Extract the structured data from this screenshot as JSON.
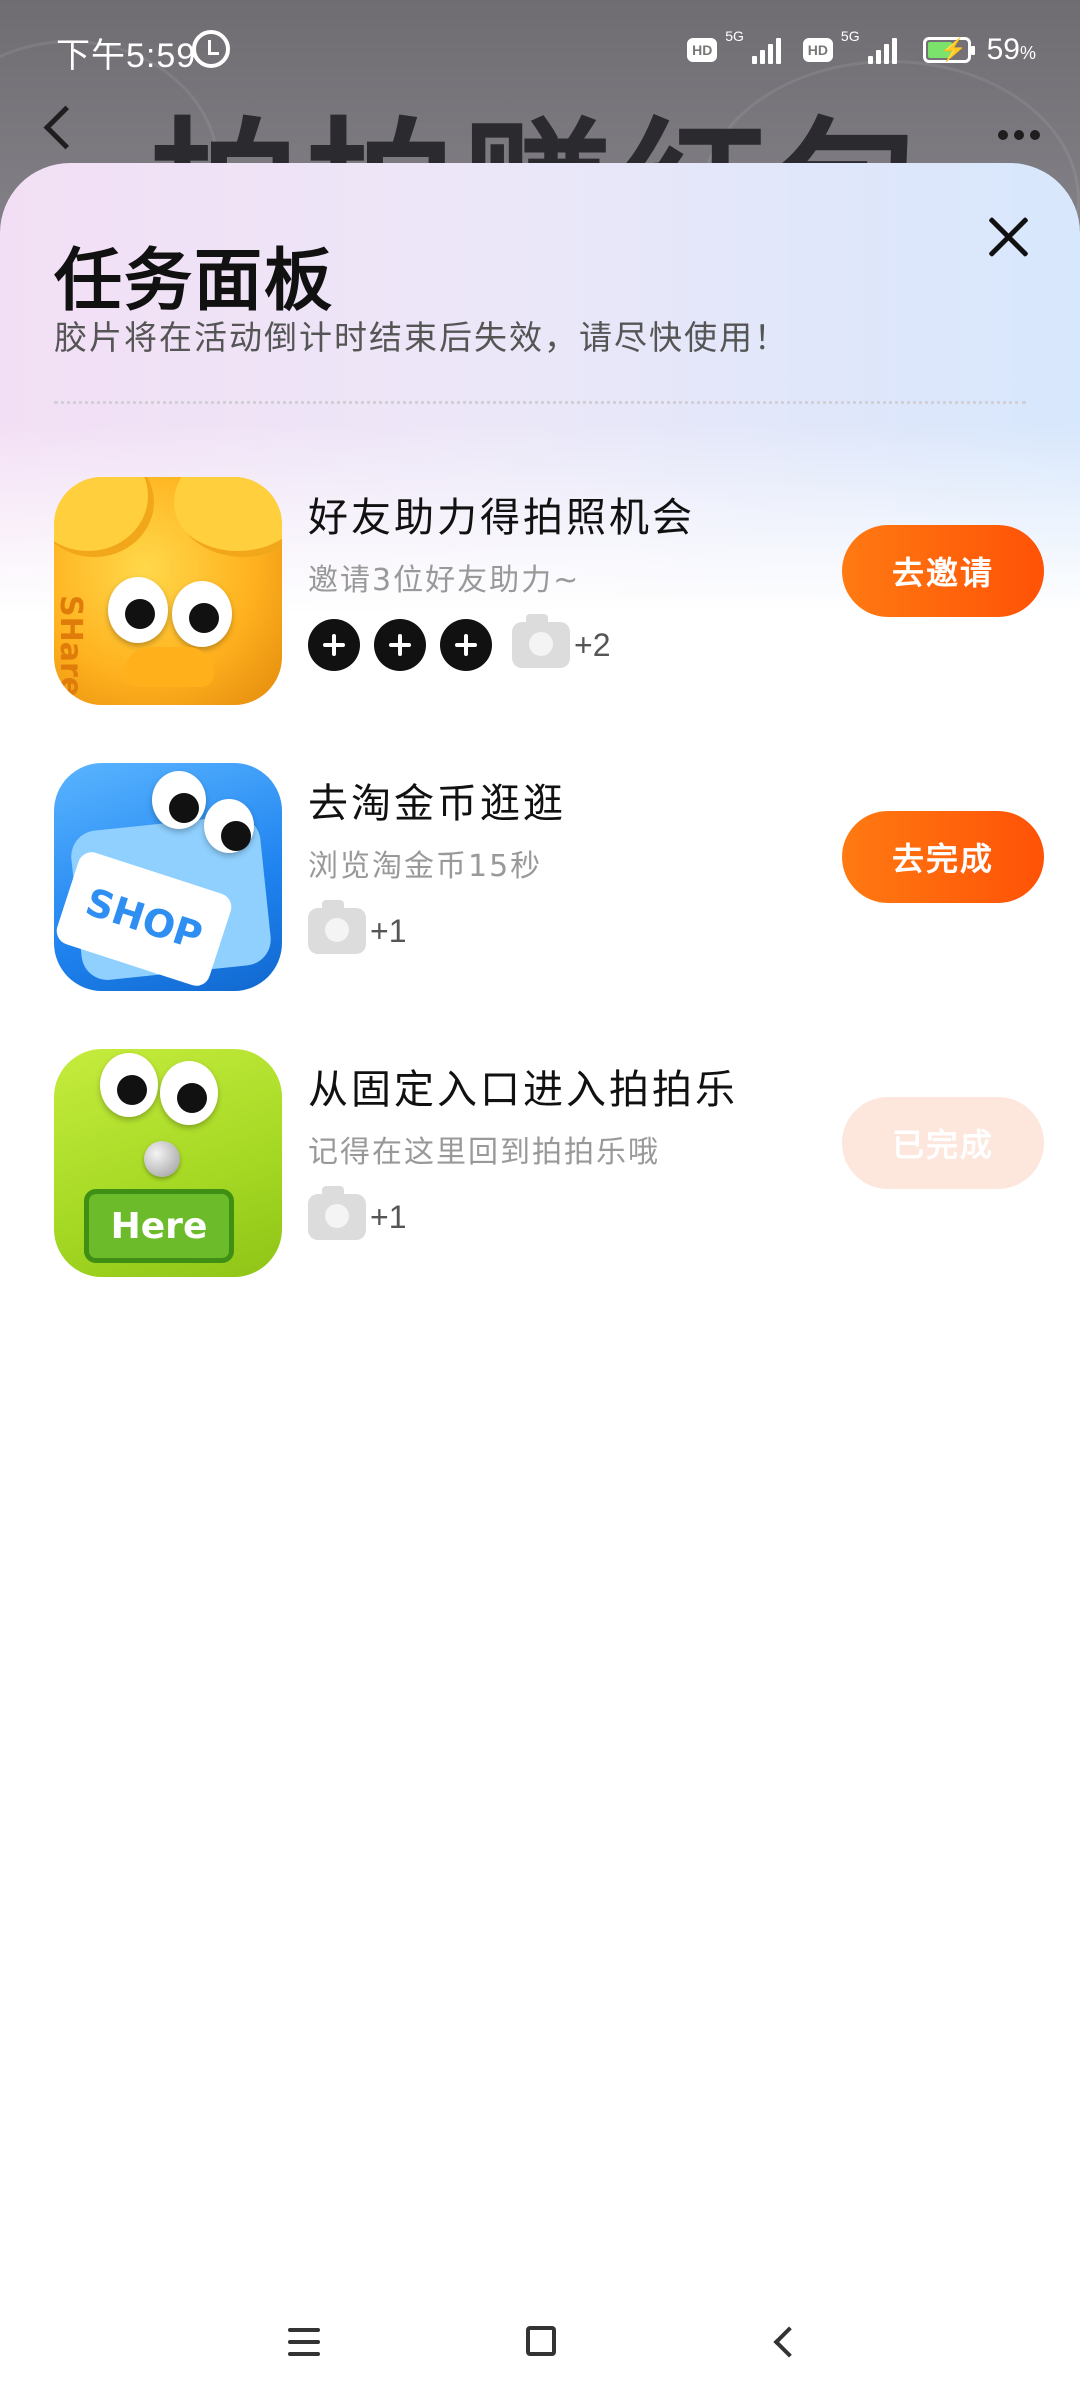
{
  "status_bar": {
    "time": "下午5:59",
    "battery": "59",
    "hd_1": "HD",
    "hd_2": "HD",
    "net_1": "5G",
    "net_2": "5G"
  },
  "background_page": {
    "title": "拍拍赚红包"
  },
  "panel": {
    "title": "任务面板",
    "subtitle": "胶片将在活动倒计时结束后失效，请尽快使用！"
  },
  "tasks": [
    {
      "title": "好友助力得拍照机会",
      "description": "邀请3位好友助力~",
      "reward": "+2",
      "button": "去邀请",
      "thumb_text": "SHare"
    },
    {
      "title": "去淘金币逛逛",
      "description": "浏览淘金币15秒",
      "reward": "+1",
      "button": "去完成",
      "thumb_text": "SHOP"
    },
    {
      "title": "从固定入口进入拍拍乐",
      "description": "记得在这里回到拍拍乐哦",
      "reward": "+1",
      "button": "已完成",
      "thumb_text": "Here"
    }
  ],
  "colors": {
    "accent_orange": "#ff6a0c",
    "done_button": "#fde6dc"
  }
}
